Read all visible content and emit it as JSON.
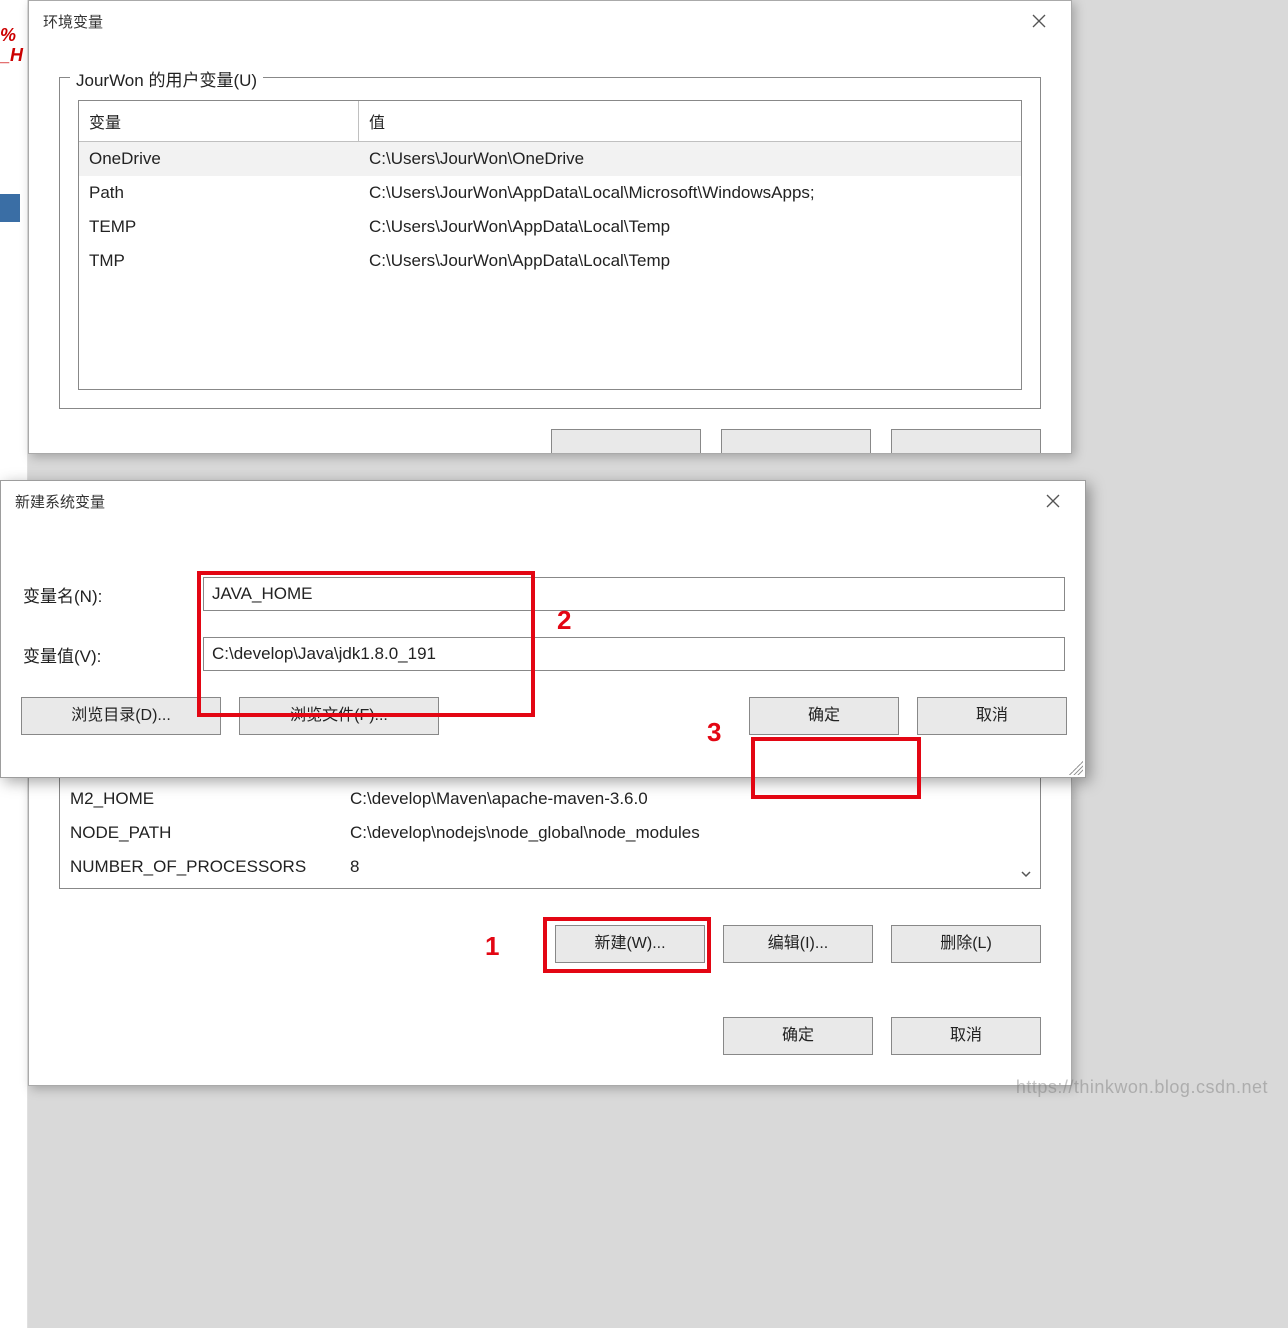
{
  "background": {
    "fragment_text": "%\n_H"
  },
  "env_dialog": {
    "title": "环境变量",
    "user_group_label": "JourWon 的用户变量(U)",
    "columns": {
      "var": "变量",
      "val": "值"
    },
    "user_rows": [
      {
        "var": "OneDrive",
        "val": "C:\\Users\\JourWon\\OneDrive",
        "selected": true
      },
      {
        "var": "Path",
        "val": "C:\\Users\\JourWon\\AppData\\Local\\Microsoft\\WindowsApps;",
        "selected": false
      },
      {
        "var": "TEMP",
        "val": "C:\\Users\\JourWon\\AppData\\Local\\Temp",
        "selected": false
      },
      {
        "var": "TMP",
        "val": "C:\\Users\\JourWon\\AppData\\Local\\Temp",
        "selected": false
      }
    ]
  },
  "new_var_dialog": {
    "title": "新建系统变量",
    "name_label": "变量名(N):",
    "value_label": "变量值(V):",
    "name_value": "JAVA_HOME",
    "value_value": "C:\\develop\\Java\\jdk1.8.0_191",
    "browse_dir_label": "浏览目录(D)...",
    "browse_file_label": "浏览文件(F)...",
    "ok_label": "确定",
    "cancel_label": "取消"
  },
  "sys_section": {
    "rows": [
      {
        "var": "M2_HOME",
        "val": "C:\\develop\\Maven\\apache-maven-3.6.0"
      },
      {
        "var": "NODE_PATH",
        "val": "C:\\develop\\nodejs\\node_global\\node_modules"
      },
      {
        "var": "NUMBER_OF_PROCESSORS",
        "val": "8"
      }
    ],
    "new_label": "新建(W)...",
    "edit_label": "编辑(I)...",
    "delete_label": "删除(L)",
    "ok_label": "确定",
    "cancel_label": "取消"
  },
  "annotations": {
    "one": "1",
    "two": "2",
    "three": "3"
  },
  "watermark": "https://thinkwon.blog.csdn.net"
}
